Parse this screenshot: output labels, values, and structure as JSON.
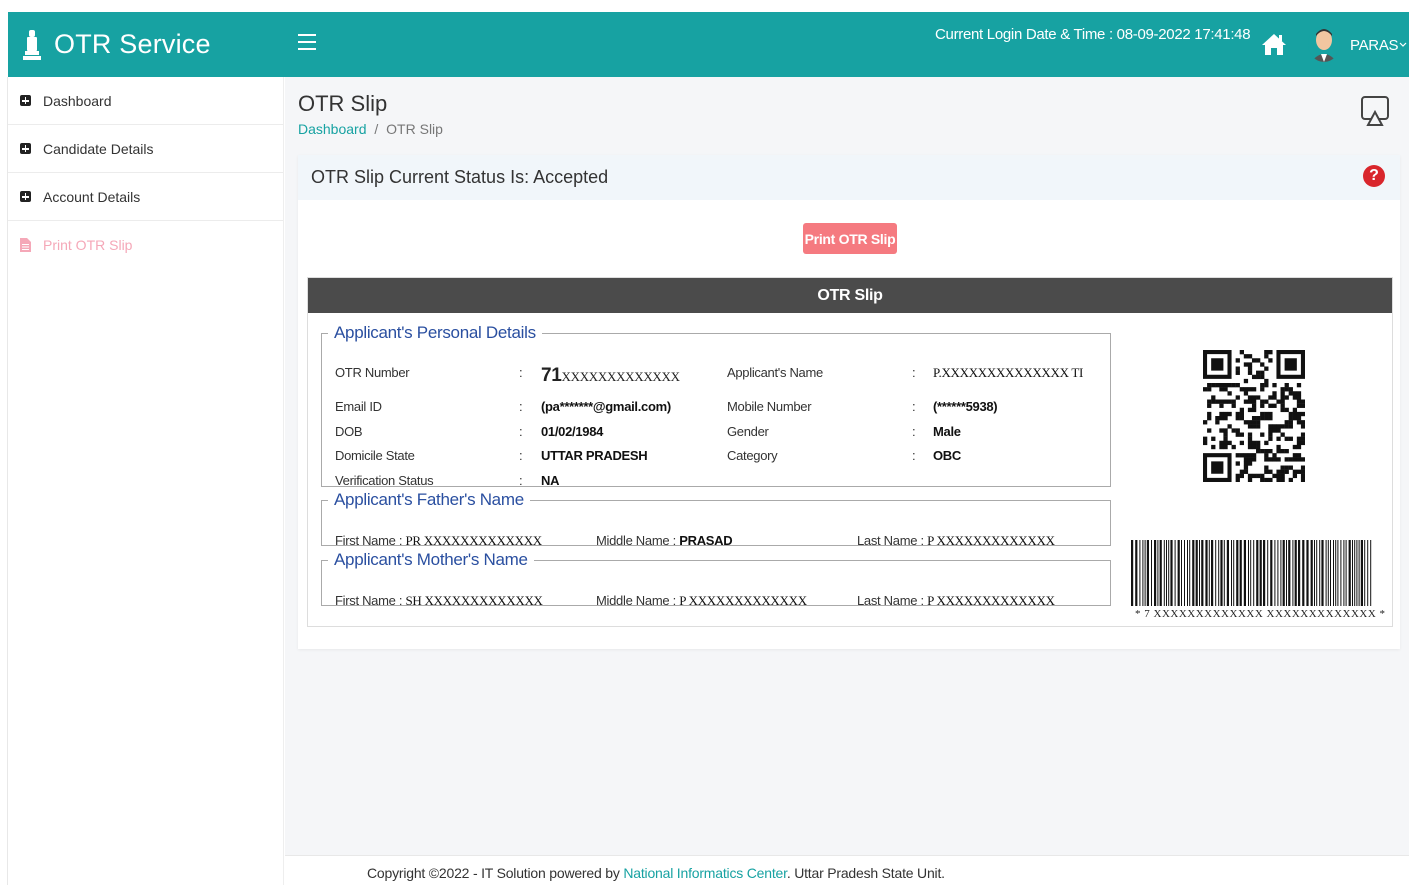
{
  "app": {
    "title": "OTR Service",
    "accent_color": "#17a2a2"
  },
  "header": {
    "login_time": "Current Login Date & Time : 08-09-2022 17:41:48",
    "username": "PARAS",
    "icons": [
      "menu-icon",
      "home-icon",
      "avatar",
      "chevron-down-icon"
    ]
  },
  "sidebar": {
    "items": [
      {
        "label": "Dashboard",
        "icon": "plus-square-icon"
      },
      {
        "label": "Candidate Details",
        "icon": "plus-square-icon"
      },
      {
        "label": "Account Details",
        "icon": "plus-square-icon"
      },
      {
        "label": "Print OTR Slip",
        "icon": "file-icon"
      }
    ]
  },
  "page": {
    "title": "OTR Slip",
    "breadcrumb": {
      "home": "Dashboard",
      "separator": "/",
      "current": "OTR Slip"
    }
  },
  "card": {
    "status": "OTR Slip Current Status Is: Accepted",
    "print_button": "Print OTR Slip",
    "slip_title": "OTR Slip"
  },
  "personal": {
    "legend": "Applicant's Personal Details",
    "otr_label": "OTR Number",
    "otr_prefix": "71",
    "otr_value": "XXXXXXXXXXXXX",
    "name_label": "Applicant's Name",
    "name_value": "P.XXXXXXXXXXXXXX TI",
    "email_label": "Email ID",
    "email_value": "(pa*******@gmail.com)",
    "mobile_label": "Mobile Number",
    "mobile_value": "(******5938)",
    "dob_label": "DOB",
    "dob_value": "01/02/1984",
    "gender_label": "Gender",
    "gender_value": "Male",
    "state_label": "Domicile State",
    "state_value": "UTTAR PRADESH",
    "category_label": "Category",
    "category_value": "OBC",
    "verification_label": "Verification Status",
    "verification_value": "NA",
    "colon": ":"
  },
  "father": {
    "legend": "Applicant's Father's Name",
    "first_label": "First Name :",
    "first_value": "PR XXXXXXXXXXXXX",
    "middle_label": "Middle Name :",
    "middle_value": "PRASAD",
    "last_label": "Last Name :",
    "last_value": "P XXXXXXXXXXXXX"
  },
  "mother": {
    "legend": "Applicant's Mother's Name",
    "first_label": "First Name :",
    "first_value": "SH XXXXXXXXXXXXX",
    "middle_label": "Middle Name :",
    "middle_value": "P XXXXXXXXXXXXX",
    "last_label": "Last Name :",
    "last_value": "P XXXXXXXXXXXXX"
  },
  "barcode": {
    "text": "*  7   XXXXXXXXXXXXX XXXXXXXXXXXXX  *"
  },
  "footer": {
    "prefix": "Copyright ©2022 - IT Solution powered by ",
    "link": "National Informatics Center",
    "suffix": ". Uttar Pradesh State Unit."
  }
}
